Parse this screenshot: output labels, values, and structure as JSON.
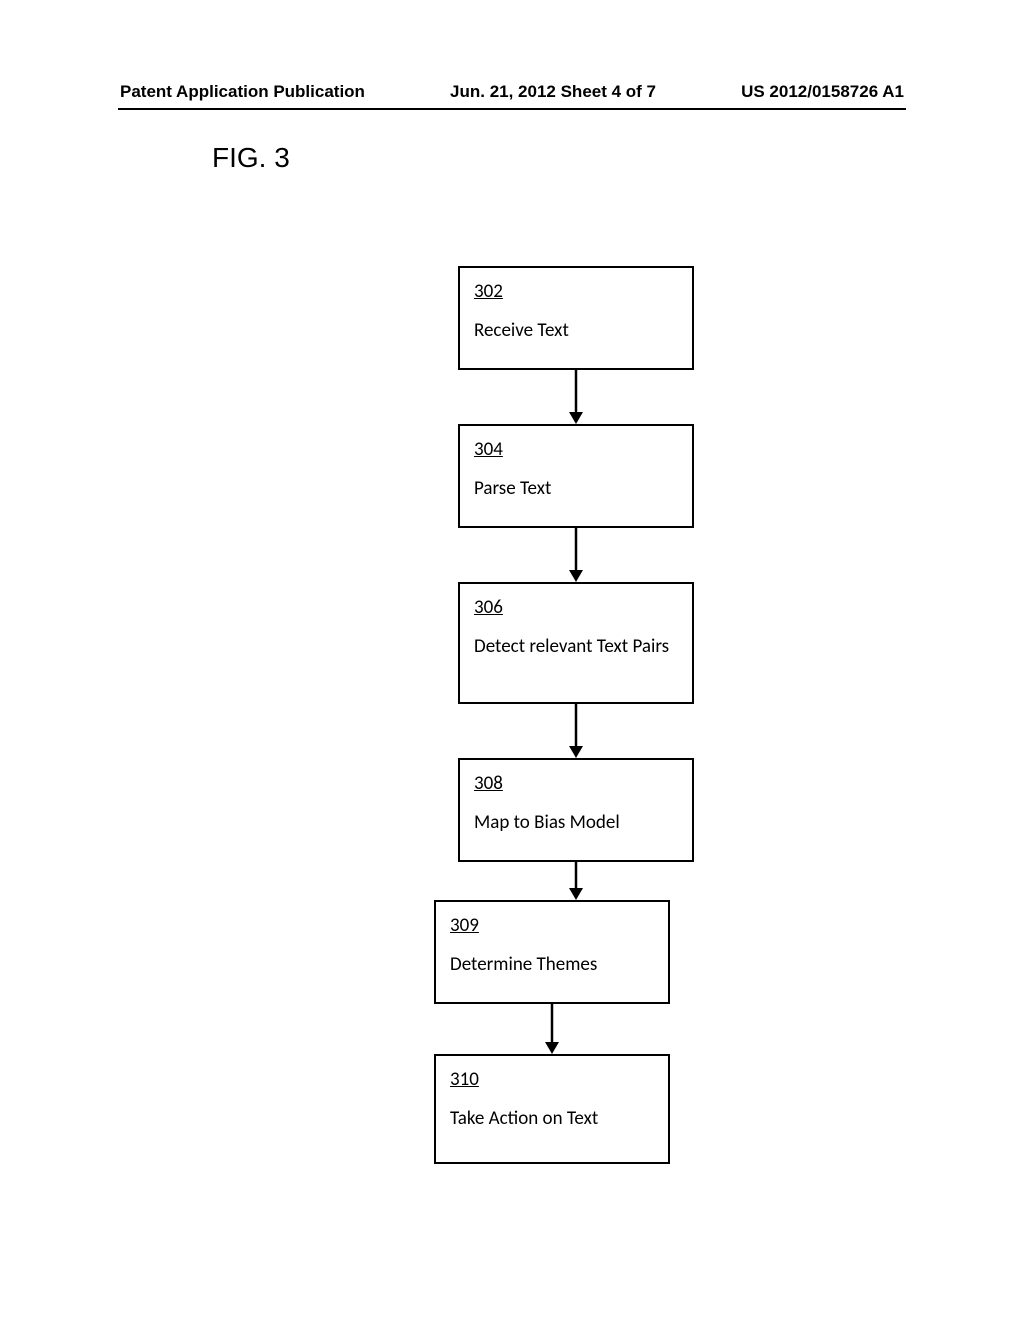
{
  "header": {
    "left": "Patent Application Publication",
    "center": "Jun. 21, 2012   Sheet 4 of 7",
    "right": "US 2012/0158726 A1"
  },
  "figure_label": "FIG. 3",
  "steps": [
    {
      "ref": "302",
      "label": "Receive Text"
    },
    {
      "ref": "304",
      "label": "Parse Text"
    },
    {
      "ref": "306",
      "label": "Detect relevant Text Pairs"
    },
    {
      "ref": "308",
      "label": "Map to Bias Model"
    },
    {
      "ref": "309",
      "label": "Determine Themes"
    },
    {
      "ref": "310",
      "label": "Take Action on Text"
    }
  ]
}
